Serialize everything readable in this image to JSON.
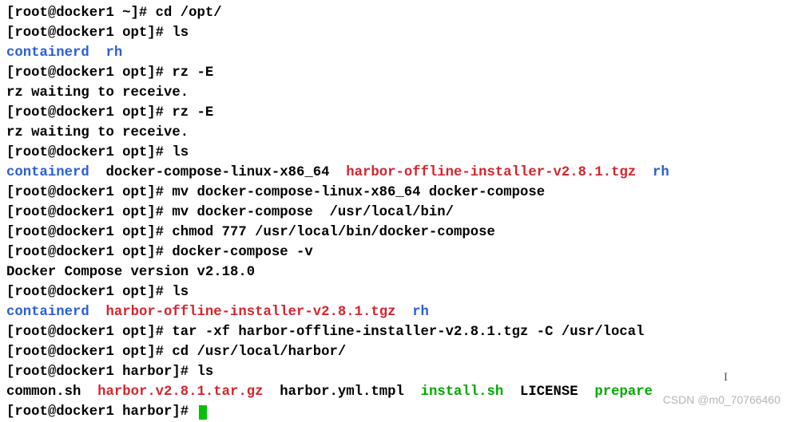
{
  "prompts": {
    "home": "[root@docker1 ~]# ",
    "opt": "[root@docker1 opt]# ",
    "harbor": "[root@docker1 harbor]# "
  },
  "cmds": {
    "cd_opt": "cd /opt/",
    "ls": "ls",
    "rz_e": "rz -E",
    "mv_rename": "mv docker-compose-linux-x86_64 docker-compose",
    "mv_bin": "mv docker-compose  /usr/local/bin/",
    "chmod": "chmod 777 /usr/local/bin/docker-compose",
    "dc_v": "docker-compose -v",
    "tar": "tar -xf harbor-offline-installer-v2.8.1.tgz -C /usr/local",
    "cd_harbor": "cd /usr/local/harbor/"
  },
  "out": {
    "rz_wait": "rz waiting to receive.",
    "dc_version": "Docker Compose version v2.18.0"
  },
  "ls1": {
    "containerd": "containerd",
    "rh": "rh"
  },
  "ls2": {
    "containerd": "containerd",
    "dcl": "docker-compose-linux-x86_64",
    "harbor": "harbor-offline-installer-v2.8.1.tgz",
    "rh": "rh"
  },
  "ls3": {
    "containerd": "containerd",
    "harbor": "harbor-offline-installer-v2.8.1.tgz",
    "rh": "rh"
  },
  "ls4": {
    "common": "common.sh",
    "hvtgz": "harbor.v2.8.1.tar.gz",
    "yml": "harbor.yml.tmpl",
    "install": "install.sh",
    "license": "LICENSE",
    "prepare": "prepare"
  },
  "watermark": "CSDN @m0_70766460"
}
